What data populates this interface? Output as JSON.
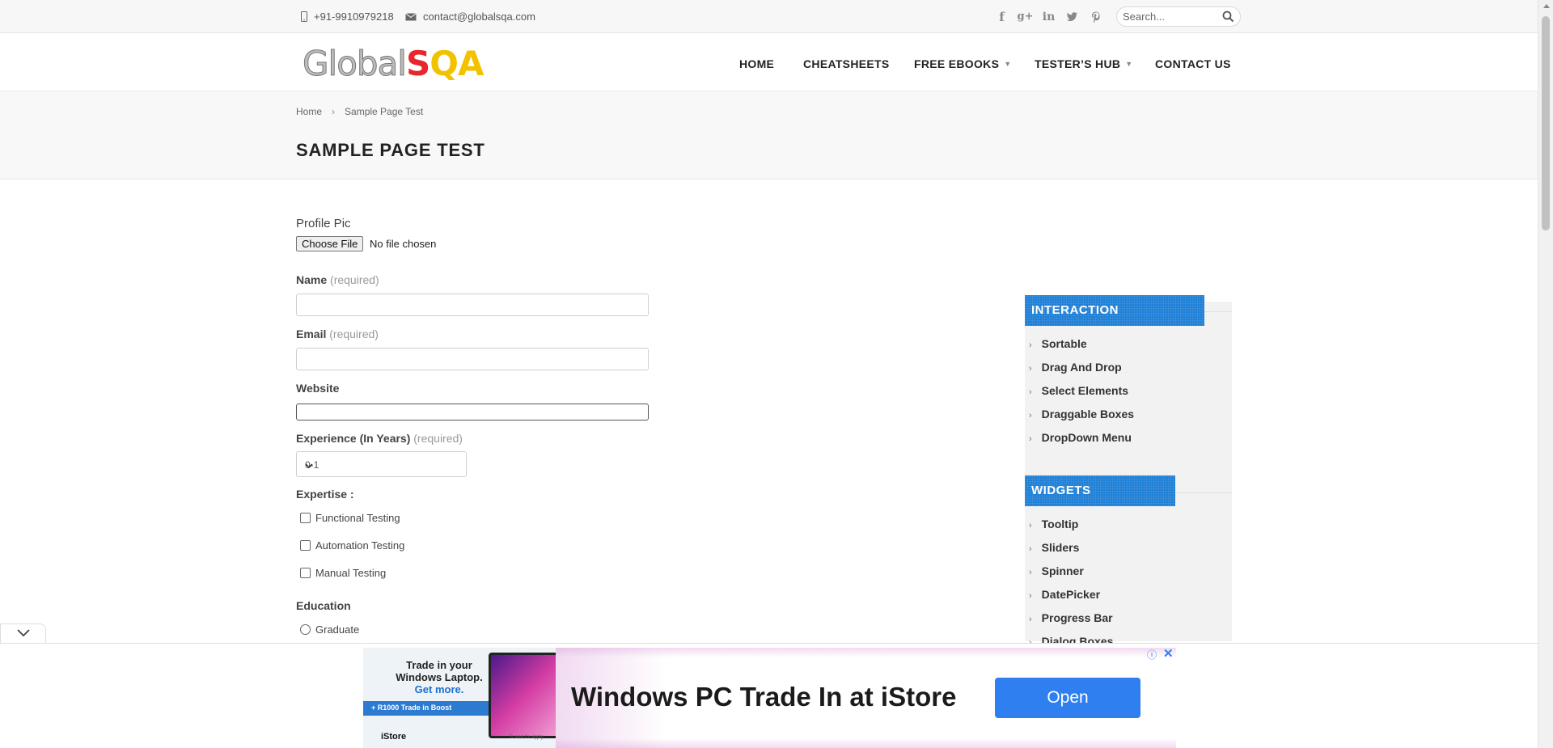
{
  "topbar": {
    "phone": "+91-9910979218",
    "email": "contact@globalsqa.com",
    "social_icons": [
      "facebook-icon",
      "google-plus-icon",
      "linkedin-icon",
      "twitter-icon",
      "pinterest-icon"
    ],
    "search_placeholder": "Search..."
  },
  "header": {
    "logo_global": "Global",
    "logo_s": "S",
    "logo_qa": "QA",
    "nav": [
      {
        "label": "HOME"
      },
      {
        "label": "CHEATSHEETS"
      },
      {
        "label": "FREE EBOOKS"
      },
      {
        "label": "TESTER’S HUB"
      },
      {
        "label": "CONTACT US"
      }
    ]
  },
  "breadcrumb": {
    "home": "Home",
    "separator": "›",
    "current": "Sample Page Test"
  },
  "page_title": "SAMPLE PAGE TEST",
  "form": {
    "profile_pic_label": "Profile Pic",
    "choose_file": "Choose File",
    "no_file": "No file chosen",
    "name_label": "Name",
    "email_label": "Email",
    "website_label": "Website",
    "required_text": "(required)",
    "experience_label": "Experience (In Years)",
    "experience_value": "0-1",
    "expertise_label": "Expertise :",
    "expertise_options": [
      "Functional Testing",
      "Automation Testing",
      "Manual Testing"
    ],
    "education_label": "Education",
    "education_options": [
      "Graduate"
    ]
  },
  "sidebar": {
    "interaction_title": "INTERACTION",
    "interaction_items": [
      "Sortable",
      "Drag And Drop",
      "Select Elements",
      "Draggable Boxes",
      "DropDown Menu"
    ],
    "widgets_title": "WIDGETS",
    "widgets_items": [
      "Tooltip",
      "Sliders",
      "Spinner",
      "DatePicker",
      "Progress Bar",
      "Dialog Boxes"
    ],
    "arrow": "›"
  },
  "ad": {
    "headline": "Windows PC Trade In at iStore",
    "button": "Open",
    "image_line1": "Trade in your Windows Laptop.",
    "image_line2": "Get more.",
    "image_strip": "+ R1000 Trade in Boost",
    "image_brand": "iStore",
    "image_terms": "Ts and Cs apply",
    "info_icon": "ⓘ",
    "close_icon": "✕"
  },
  "colors": {
    "widget_blue": "#1e7fd6",
    "logo_red": "#e8262b",
    "logo_yellow": "#f2c200",
    "ad_button": "#2f7ff0"
  }
}
